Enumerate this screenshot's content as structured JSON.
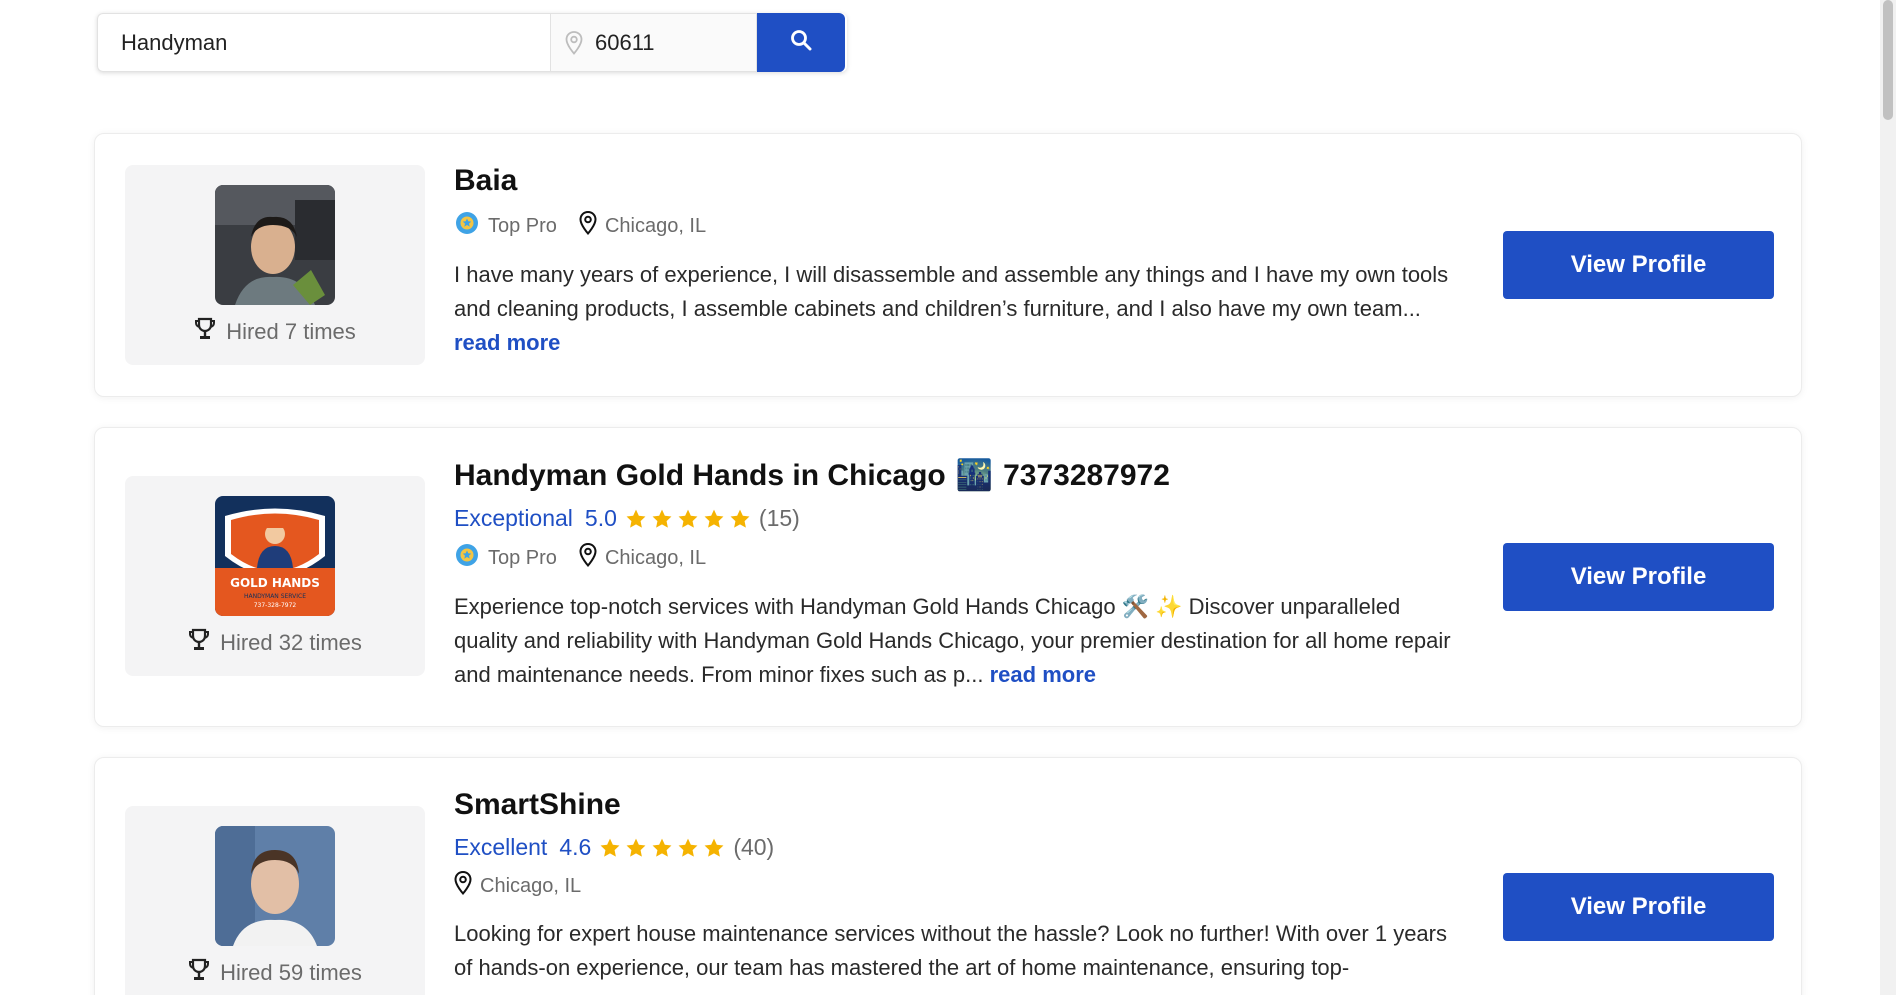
{
  "search": {
    "service_value": "Handyman",
    "zip_value": "60611"
  },
  "pros": [
    {
      "name": "Baia",
      "hired": "Hired 7 times",
      "badge": "Top Pro",
      "location": "Chicago, IL",
      "description": "I have many years of experience, I will disassemble and assemble any things and I have my own tools and cleaning products, I assemble cabinets and children’s furniture, and I also have my own team...",
      "read_more": "read more",
      "button": "View Profile"
    },
    {
      "name": "Handyman Gold Hands in Chicago",
      "name_emoji": "🌃",
      "name_phone": "7373287972",
      "rating_word": "Exceptional",
      "rating": "5.0",
      "rating_stars": 5,
      "review_count": "(15)",
      "hired": "Hired 32 times",
      "badge": "Top Pro",
      "location": "Chicago, IL",
      "logo_text": "GOLD HANDS",
      "logo_subtext": "HANDYMAN SERVICE",
      "logo_phone": "737-328-7972",
      "description": "Experience top-notch services with Handyman Gold Hands Chicago 🛠️ ✨ Discover unparalleled quality and reliability with Handyman Gold Hands Chicago, your premier destination for all home repair and maintenance needs. From minor fixes such as p...",
      "read_more": "read more",
      "button": "View Profile"
    },
    {
      "name": "SmartShine",
      "rating_word": "Excellent",
      "rating": "4.6",
      "rating_stars": 4.6,
      "review_count": "(40)",
      "hired": "Hired 59 times",
      "location": "Chicago, IL",
      "description": "Looking for expert house maintenance services without the hassle? Look no further! With over 1 years of hands-on experience, our team has mastered the art of home maintenance, ensuring top-",
      "button": "View Profile"
    }
  ],
  "colors": {
    "accent": "#1f4fc4",
    "star": "#f5b301",
    "badge": "#3fa3e6"
  }
}
